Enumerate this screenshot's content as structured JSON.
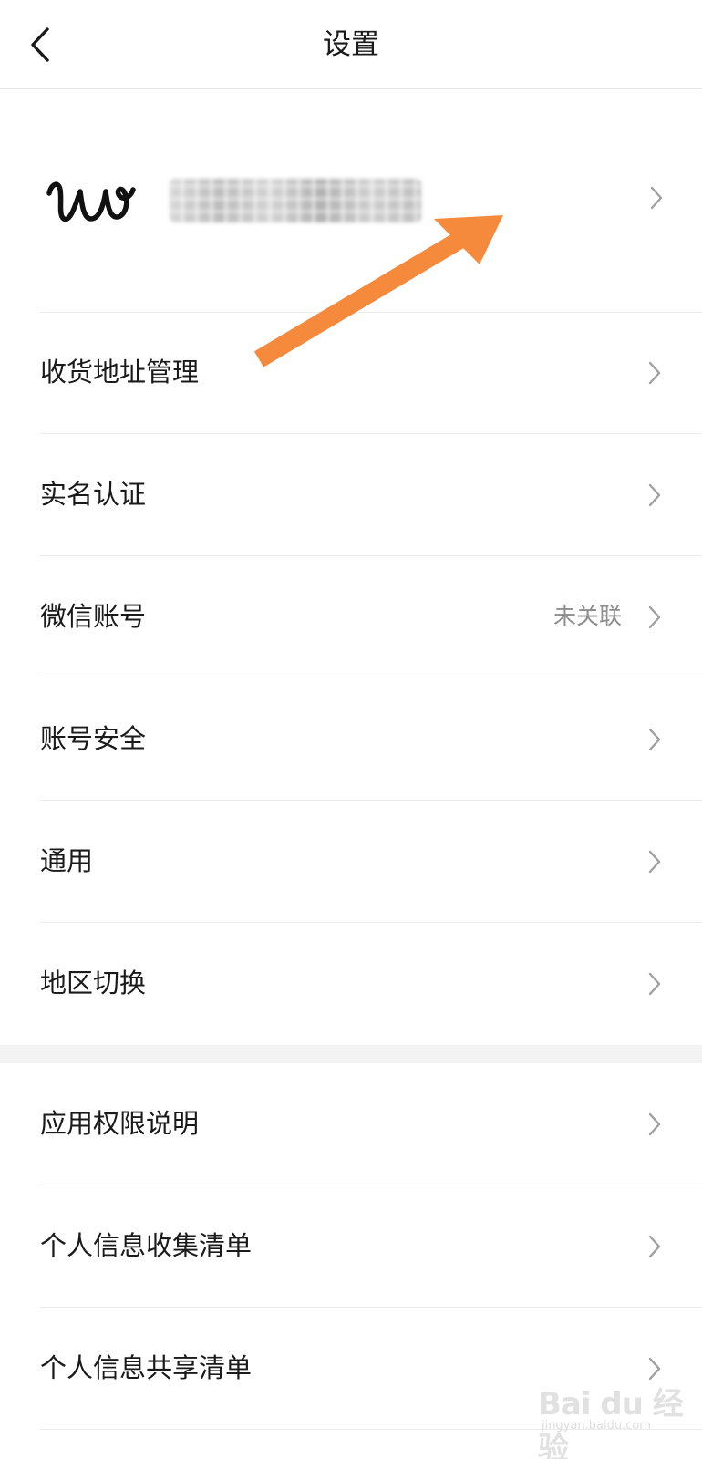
{
  "header": {
    "title": "设置",
    "back_icon": "chevron-left-icon"
  },
  "profile": {
    "avatar_text": "w",
    "name_masked": true,
    "chevron_icon": "chevron-right-icon"
  },
  "section_one": [
    {
      "label": "收货地址管理"
    },
    {
      "label": "实名认证"
    },
    {
      "label": "微信账号",
      "value": "未关联"
    },
    {
      "label": "账号安全"
    },
    {
      "label": "通用"
    },
    {
      "label": "地区切换"
    }
  ],
  "section_two": [
    {
      "label": "应用权限说明"
    },
    {
      "label": "个人信息收集清单"
    },
    {
      "label": "个人信息共享清单"
    }
  ],
  "annotation": {
    "arrow_color": "#F58A3C",
    "arrow_icon": "annotation-arrow"
  },
  "watermark": {
    "text": "Bai du 经验",
    "sub": "jingyan.baidu.com"
  },
  "colors": {
    "divider": "#ececec",
    "secondary_text": "#8e8e8e",
    "chevron": "#a0a0a0"
  }
}
